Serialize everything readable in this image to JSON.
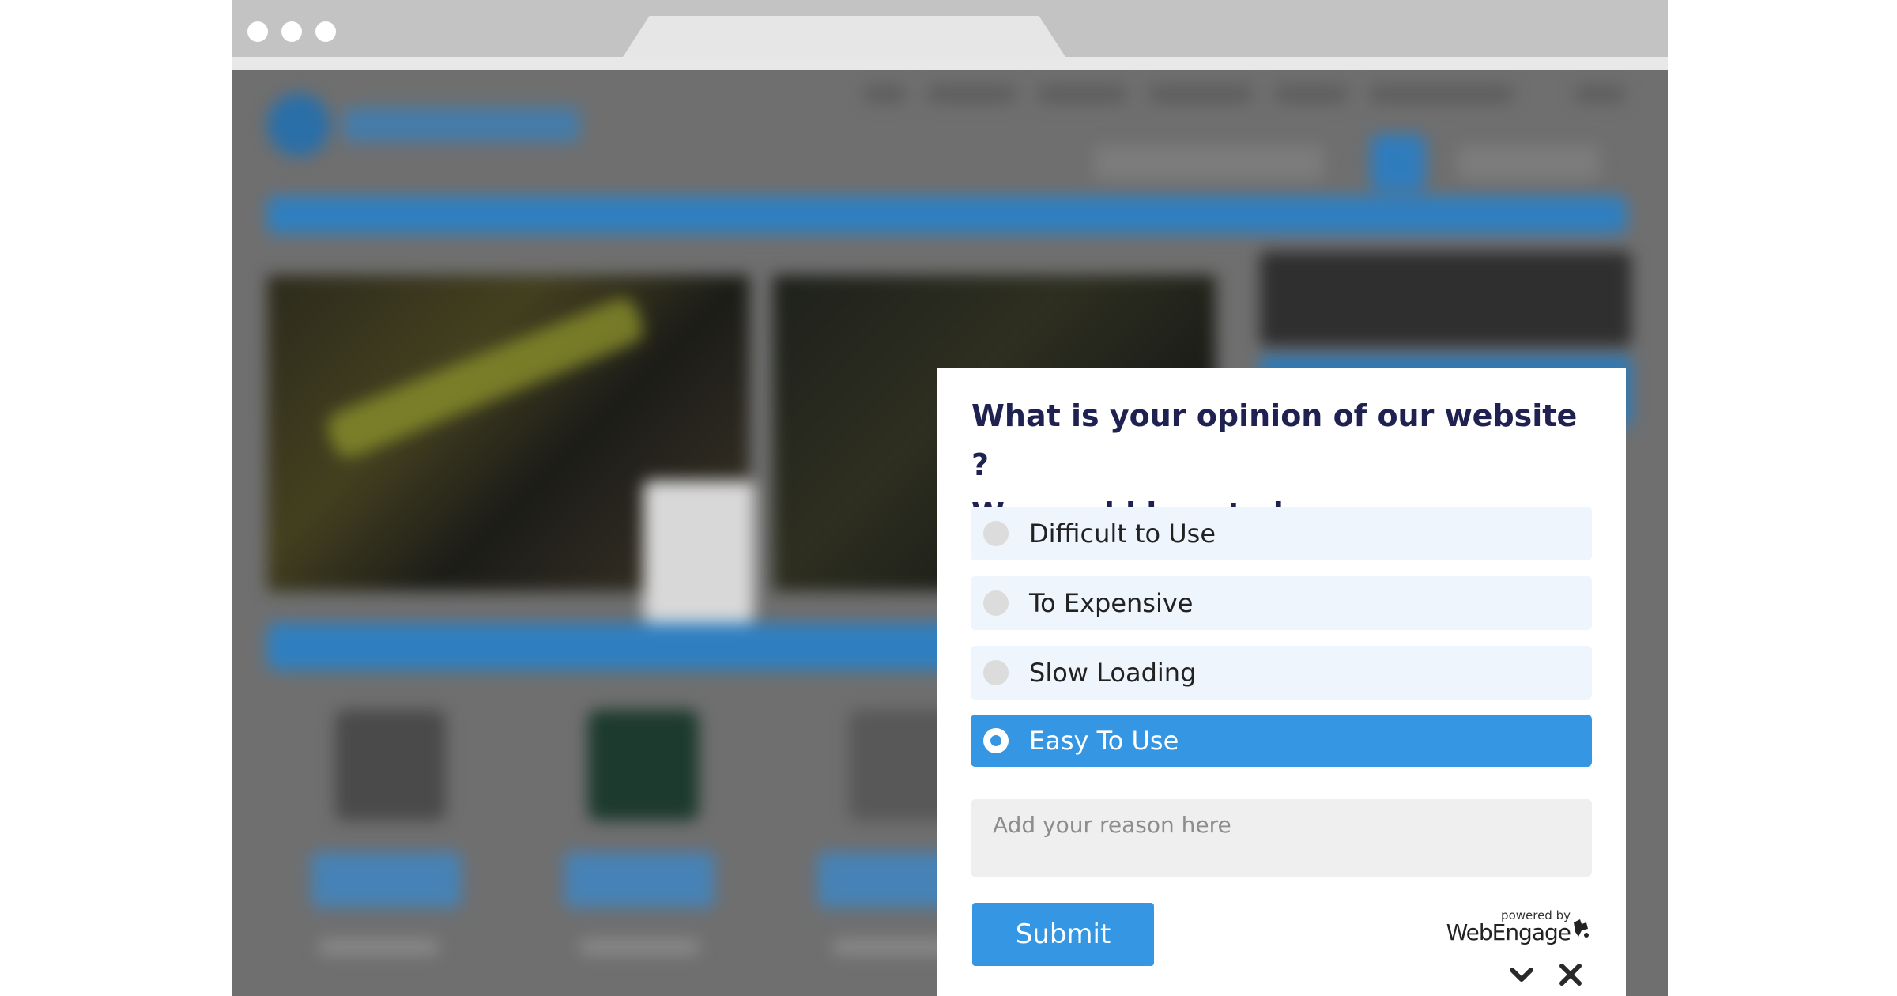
{
  "colors": {
    "accent": "#3597e3",
    "question_text": "#1f2150",
    "option_bg": "#eef5fd"
  },
  "survey": {
    "question_line1": "What is your opinion of our website ?",
    "question_line2": "We would love to hear.",
    "options": [
      {
        "label": "Difficult to Use",
        "selected": false
      },
      {
        "label": "To Expensive",
        "selected": false
      },
      {
        "label": "Slow Loading",
        "selected": false
      },
      {
        "label": "Easy To Use",
        "selected": true
      }
    ],
    "reason_placeholder": "Add your reason here",
    "submit_label": "Submit",
    "powered_by_small": "powered by",
    "powered_by_brand": "WebEngage",
    "icons": {
      "brand": "webengage-logo-icon",
      "minimize": "chevron-down-icon",
      "close": "close-icon"
    }
  }
}
